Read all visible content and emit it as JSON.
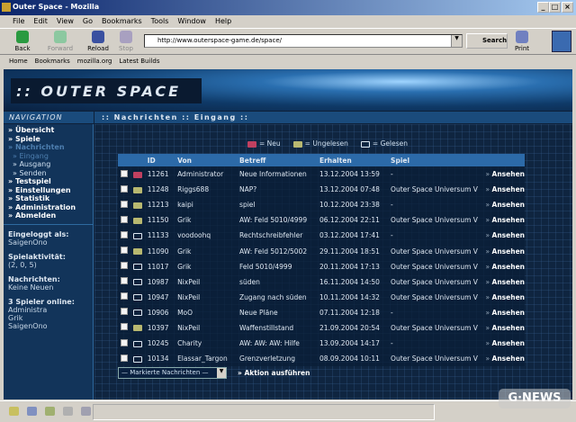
{
  "window": {
    "title": "Outer Space - Mozilla"
  },
  "menu": [
    "File",
    "Edit",
    "View",
    "Go",
    "Bookmarks",
    "Tools",
    "Window",
    "Help"
  ],
  "toolbar": {
    "back": "Back",
    "forward": "Forward",
    "reload": "Reload",
    "stop": "Stop",
    "url": "http://www.outerspace-game.de/space/",
    "search": "Search",
    "print": "Print"
  },
  "personal_bar": [
    "Home",
    "Bookmarks",
    "mozilla.org",
    "Latest Builds"
  ],
  "site": {
    "logo": ":: OUTER SPACE",
    "nav_title": "NAVIGATION",
    "breadcrumb": ":: Nachrichten :: Eingang ::"
  },
  "nav": [
    {
      "label": "» Übersicht"
    },
    {
      "label": "» Spiele"
    },
    {
      "label": "» Nachrichten",
      "active": true
    },
    {
      "label": "» Eingang",
      "sub": true,
      "active": true
    },
    {
      "label": "» Ausgang",
      "sub": true
    },
    {
      "label": "» Senden",
      "sub": true
    },
    {
      "label": "» Testspiel"
    },
    {
      "label": "» Einstellungen"
    },
    {
      "label": "» Statistik"
    },
    {
      "label": "» Administration"
    },
    {
      "label": "» Abmelden"
    }
  ],
  "info": {
    "logged_in_label": "Eingeloggt als:",
    "logged_in_value": "SaigenOno",
    "activity_label": "Spielaktivität:",
    "activity_value": "(2, 0, 5)",
    "messages_label": "Nachrichten:",
    "messages_value": "Keine Neuen",
    "online_label": "3 Spieler online:",
    "online_players": [
      "Administra",
      "Grik",
      "SaigenOno"
    ]
  },
  "legend": {
    "new": "= Neu",
    "unread": "= Ungelesen",
    "read": "= Gelesen"
  },
  "colors": {
    "new": "#c04060",
    "unread": "#b8b870",
    "header": "#2c6aa8"
  },
  "table": {
    "headers": [
      "ID",
      "Von",
      "Betreff",
      "Erhalten",
      "Spiel"
    ],
    "view_label": "Ansehen",
    "rows": [
      {
        "status": "new",
        "id": "11261",
        "from": "Administrator",
        "subject": "Neue Informationen",
        "received": "13.12.2004 13:59",
        "game": "-"
      },
      {
        "status": "unread",
        "id": "11248",
        "from": "Riggs688",
        "subject": "NAP?",
        "received": "13.12.2004 07:48",
        "game": "Outer Space Universum V"
      },
      {
        "status": "unread",
        "id": "11213",
        "from": "kaipi",
        "subject": "spiel",
        "received": "10.12.2004 23:38",
        "game": "-"
      },
      {
        "status": "unread",
        "id": "11150",
        "from": "Grik",
        "subject": "AW: Feld 5010/4999",
        "received": "06.12.2004 22:11",
        "game": "Outer Space Universum V"
      },
      {
        "status": "read",
        "id": "11133",
        "from": "voodoohq",
        "subject": "Rechtschreibfehler",
        "received": "03.12.2004 17:41",
        "game": "-"
      },
      {
        "status": "unread",
        "id": "11090",
        "from": "Grik",
        "subject": "AW: Feld 5012/5002",
        "received": "29.11.2004 18:51",
        "game": "Outer Space Universum V"
      },
      {
        "status": "read",
        "id": "11017",
        "from": "Grik",
        "subject": "Feld 5010/4999",
        "received": "20.11.2004 17:13",
        "game": "Outer Space Universum V"
      },
      {
        "status": "read",
        "id": "10987",
        "from": "NixPeil",
        "subject": "süden",
        "received": "16.11.2004 14:50",
        "game": "Outer Space Universum V"
      },
      {
        "status": "read",
        "id": "10947",
        "from": "NixPeil",
        "subject": "Zugang nach süden",
        "received": "10.11.2004 14:32",
        "game": "Outer Space Universum V"
      },
      {
        "status": "read",
        "id": "10906",
        "from": "MoO",
        "subject": "Neue Pläne",
        "received": "07.11.2004 12:18",
        "game": "-"
      },
      {
        "status": "unread",
        "id": "10397",
        "from": "NixPeil",
        "subject": "Waffenstillstand",
        "received": "21.09.2004 20:54",
        "game": "Outer Space Universum V"
      },
      {
        "status": "read",
        "id": "10245",
        "from": "Charity",
        "subject": "AW: AW: AW: Hilfe",
        "received": "13.09.2004 14:17",
        "game": "-"
      },
      {
        "status": "read",
        "id": "10134",
        "from": "Elassar_Targon",
        "subject": "Grenzverletzung",
        "received": "08.09.2004 10:11",
        "game": "Outer Space Universum V"
      }
    ]
  },
  "bulk": {
    "select_value": "— Markierte Nachrichten —",
    "action": "» Aktion ausführen"
  },
  "watermark": "G-NEWS"
}
